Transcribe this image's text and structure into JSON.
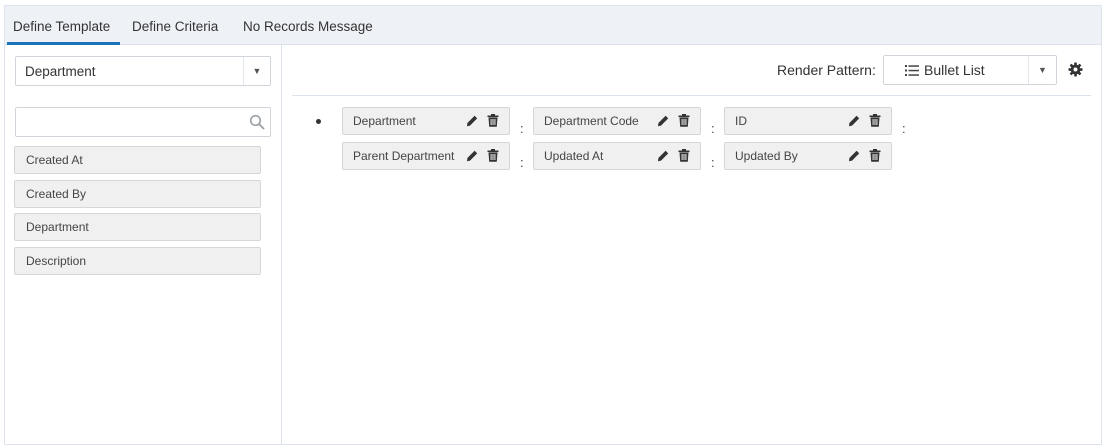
{
  "tabs": [
    {
      "label": "Define Template",
      "active": true
    },
    {
      "label": "Define Criteria",
      "active": false
    },
    {
      "label": "No Records Message",
      "active": false
    }
  ],
  "left_panel": {
    "entity_select": {
      "value": "Department"
    },
    "search": {
      "value": "",
      "placeholder": ""
    },
    "fields": [
      "Created At",
      "Created By",
      "Department",
      "Description"
    ]
  },
  "right_panel": {
    "render_pattern_label": "Render Pattern:",
    "render_pattern_value": "Bullet List",
    "row_separator": ":",
    "template_rows": [
      [
        "Department",
        "Department Code",
        "ID"
      ],
      [
        "Parent Department",
        "Updated At",
        "Updated By"
      ]
    ]
  },
  "colors": {
    "accent": "#1a73b8",
    "tab_bar_bg": "#eef2f6",
    "chip_bg": "#f0f0f0",
    "border": "#dde3ea"
  },
  "icons": [
    "search-icon",
    "list-icon",
    "gear-icon",
    "pencil-icon",
    "trash-icon",
    "chevron-down-icon"
  ]
}
